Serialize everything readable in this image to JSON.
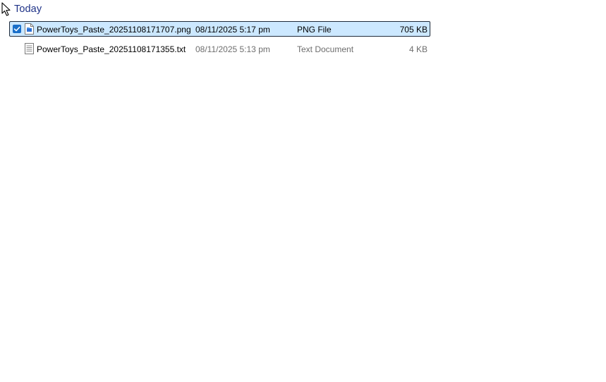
{
  "group": {
    "label": "Today"
  },
  "files": [
    {
      "name": "PowerToys_Paste_20251108171707.png",
      "date_modified": "08/11/2025 5:17 pm",
      "type": "PNG File",
      "size": "705 KB",
      "icon": "image-file-icon",
      "selected": true
    },
    {
      "name": "PowerToys_Paste_20251108171355.txt",
      "date_modified": "08/11/2025 5:13 pm",
      "type": "Text Document",
      "size": "4 KB",
      "icon": "text-file-icon",
      "selected": false
    }
  ],
  "colors": {
    "group_header": "#1e3287",
    "selection_background": "#cce8ff",
    "selection_border": "#1e2a3a",
    "checkbox": "#1a6fc9",
    "secondary_text": "#6d6d6d"
  }
}
